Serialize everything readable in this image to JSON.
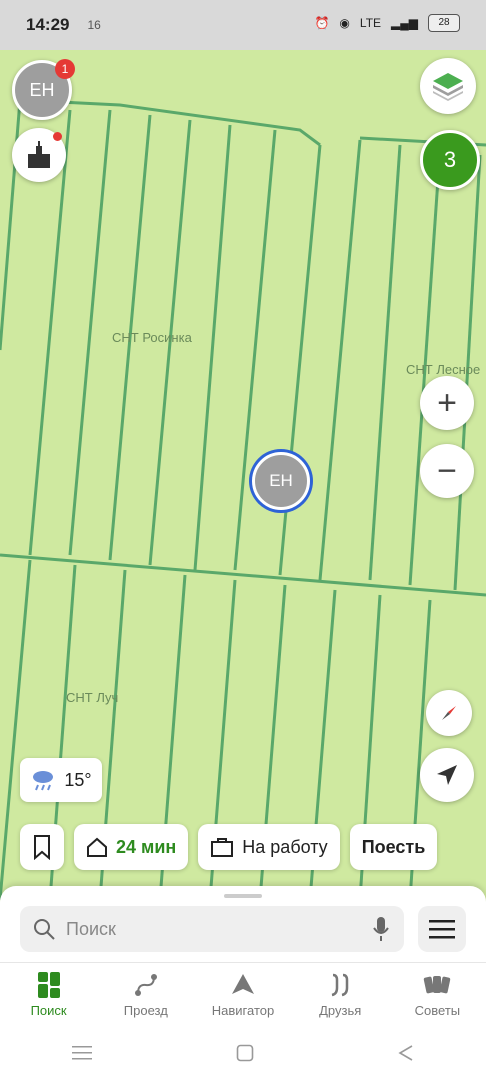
{
  "status_bar": {
    "time": "14:29",
    "extra": "16",
    "network": "LTE",
    "battery": "28"
  },
  "map": {
    "labels": {
      "snt_rosinka": "СНТ Росинка",
      "snt_lesnoe": "СНТ Лесное",
      "snt_luch": "СНТ Луч"
    },
    "avatar_initials": "ЕН",
    "notification_count": "1",
    "friends_count": "3",
    "zoom_in": "+",
    "zoom_out": "−"
  },
  "weather": {
    "temp": "15°",
    "icon": "rain-cloud-icon"
  },
  "quick_chips": [
    {
      "label": "24 мин"
    },
    {
      "label": "На работу"
    },
    {
      "label": "Поесть"
    }
  ],
  "search": {
    "placeholder": "Поиск"
  },
  "tabs": [
    {
      "label": "Поиск"
    },
    {
      "label": "Проезд"
    },
    {
      "label": "Навигатор"
    },
    {
      "label": "Друзья"
    },
    {
      "label": "Советы"
    }
  ],
  "colors": {
    "accent": "#2e8b1f",
    "map_bg": "#cfe9a0",
    "road": "#5aa86a"
  }
}
